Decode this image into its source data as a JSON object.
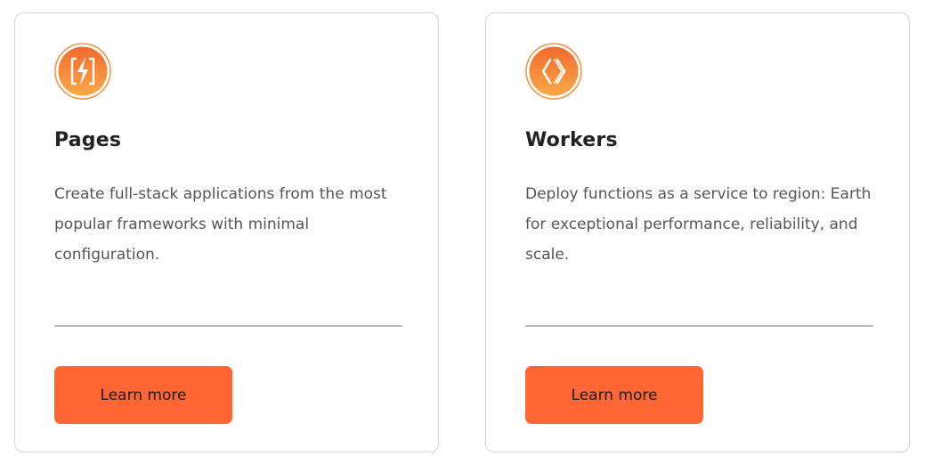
{
  "cards": [
    {
      "icon": "pages-lightning-icon",
      "title": "Pages",
      "description": "Create full-stack applications from the most popular frameworks with minimal configuration.",
      "button_label": "Learn more"
    },
    {
      "icon": "workers-code-icon",
      "title": "Workers",
      "description": "Deploy functions as a service to region: Earth for exceptional performance, reliability, and scale.",
      "button_label": "Learn more"
    }
  ],
  "colors": {
    "accent": "#ff6633",
    "icon_gradient_top": "#f26a2b",
    "icon_gradient_bottom": "#fba94a"
  }
}
